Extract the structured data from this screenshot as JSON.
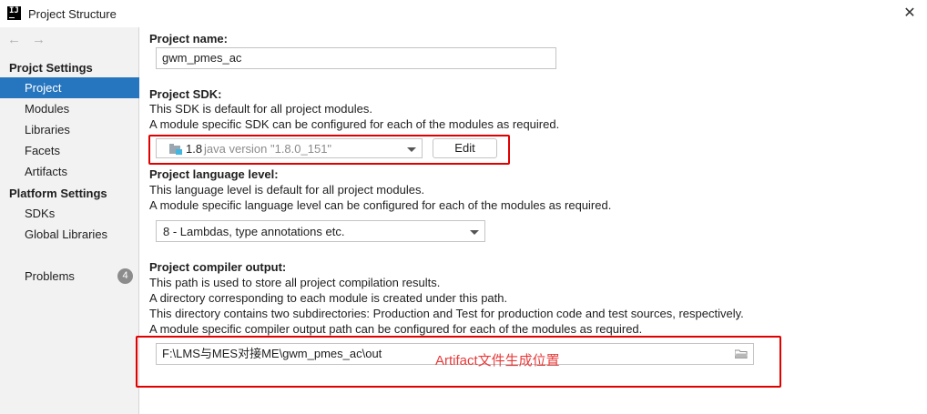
{
  "window": {
    "title": "Project Structure",
    "app_icon_text": "IJ"
  },
  "sidebar": {
    "nav_back": "←",
    "nav_forward": "→",
    "project_settings_title": "Projct Settings",
    "project_items": [
      {
        "label": "Project",
        "selected": true
      },
      {
        "label": "Modules"
      },
      {
        "label": "Libraries"
      },
      {
        "label": "Facets"
      },
      {
        "label": "Artifacts"
      }
    ],
    "platform_settings_title": "Platform Settings",
    "platform_items": [
      {
        "label": "SDKs"
      },
      {
        "label": "Global Libraries"
      }
    ],
    "problems": {
      "label": "Problems",
      "count": "4"
    }
  },
  "main": {
    "project_name": {
      "label": "Project name:",
      "value": "gwm_pmes_ac"
    },
    "project_sdk": {
      "label": "Project SDK:",
      "desc1": "This SDK is default for all project modules.",
      "desc2": "A module specific SDK can be configured for each of the modules as required.",
      "sdk_version": "1.8",
      "sdk_detail": "java version \"1.8.0_151\"",
      "edit_label": "Edit"
    },
    "language_level": {
      "label": "Project language level:",
      "desc1": "This language level is default for all project modules.",
      "desc2": "A module specific language level can be configured for each of the modules as required.",
      "value": "8 - Lambdas, type annotations etc."
    },
    "compiler_output": {
      "label": "Project compiler output:",
      "desc1": "This path is used to store all project compilation results.",
      "desc2": "A directory corresponding to each module is created under this path.",
      "desc3": "This directory contains two subdirectories: Production and Test for production code and test sources, respectively.",
      "desc4": "A module specific compiler output path can be configured for each of the modules as required.",
      "path": "F:\\LMS与MES对接ME\\gwm_pmes_ac\\out",
      "annotation": "Artifact文件生成位置"
    }
  },
  "colors": {
    "selection": "#2675bf",
    "highlight_box": "#e00000",
    "annotation": "#e83b3b"
  }
}
